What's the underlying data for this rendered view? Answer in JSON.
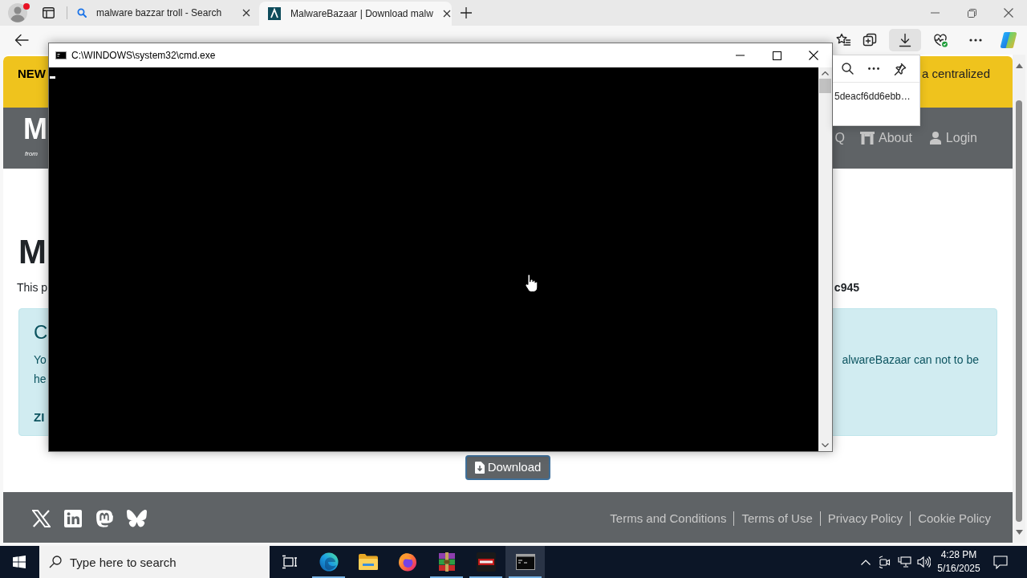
{
  "browser": {
    "tabs": [
      {
        "title": "malware bazzar troll - Search",
        "kind": "search",
        "selected": false
      },
      {
        "title": "MalwareBazaar | Download malw",
        "kind": "site",
        "selected": true
      }
    ],
    "toolbar": [
      {
        "kind": "favorites",
        "selected": false
      },
      {
        "kind": "collections",
        "selected": false
      },
      {
        "kind": "downloads",
        "selected": true
      },
      {
        "kind": "essentials",
        "selected": false
      },
      {
        "kind": "more",
        "selected": false
      },
      {
        "kind": "copilot",
        "selected": false
      }
    ]
  },
  "downloads_panel": {
    "items": [
      {
        "name": "5deacf6dd6ebb…"
      }
    ]
  },
  "page": {
    "banner": {
      "left": "NEW",
      "right": "a centralized"
    },
    "header": {
      "logo": "M",
      "tagline": "from",
      "nav": [
        {
          "label": "Q",
          "kind": "text"
        },
        {
          "label": "About",
          "kind": "about"
        },
        {
          "label": "Login",
          "kind": "login"
        }
      ]
    },
    "heading": "M",
    "intro": {
      "left": "This p",
      "right": "c945"
    },
    "notice": {
      "title": "C",
      "line_1": {
        "left": "Yo",
        "right": "alwareBazaar can not to be"
      },
      "line_2": "he",
      "code": "ZI"
    },
    "download_button": {
      "label": "Download"
    },
    "footer": {
      "social": [
        {
          "kind": "x"
        },
        {
          "kind": "linkedin"
        },
        {
          "kind": "mastodon"
        },
        {
          "kind": "bluesky"
        }
      ],
      "links": [
        "Terms and Conditions",
        "Terms of Use",
        "Privacy Policy",
        "Cookie Policy"
      ]
    }
  },
  "cmd_window": {
    "title": "C:\\WINDOWS\\system32\\cmd.exe"
  },
  "taskbar": {
    "search": {
      "placeholder": "Type here to search"
    },
    "apps": [
      {
        "kind": "task_view",
        "running": false,
        "selected": false
      },
      {
        "kind": "edge",
        "running": true,
        "selected": false
      },
      {
        "kind": "explorer",
        "running": false,
        "selected": false
      },
      {
        "kind": "firefox",
        "running": false,
        "selected": false
      },
      {
        "kind": "winrar",
        "running": true,
        "selected": false
      },
      {
        "kind": "app",
        "running": true,
        "selected": false
      },
      {
        "kind": "cmd",
        "running": true,
        "selected": true
      }
    ],
    "clock": {
      "time": "4:28 PM",
      "date": "5/16/2025"
    }
  }
}
